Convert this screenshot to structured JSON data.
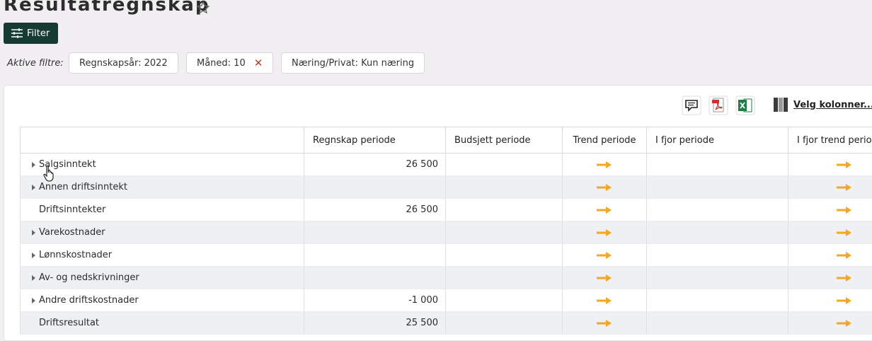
{
  "title": "Resultatregnskap",
  "filter_button": "Filter",
  "active_filters_label": "Aktive filtre:",
  "chips": [
    "Regnskapsår: 2022",
    "Måned: 10",
    "Næring/Privat: Kun næring"
  ],
  "chip_remove_glyph": "✕",
  "velg_kolonner": "Velg kolonner...",
  "columns": [
    "",
    "Regnskap periode",
    "Budsjett periode",
    "Trend periode",
    "I fjor periode",
    "I fjor trend periode"
  ],
  "rows": [
    {
      "label": "Salgsinntekt",
      "regnskap": "26 500"
    },
    {
      "label": "Annen driftsinntekt",
      "regnskap": ""
    },
    {
      "label": "Driftsinntekter",
      "regnskap": "26 500"
    },
    {
      "label": "Varekostnader",
      "regnskap": ""
    },
    {
      "label": "Lønnskostnader",
      "regnskap": ""
    },
    {
      "label": "Av- og nedskrivninger",
      "regnskap": ""
    },
    {
      "label": "Andre driftskostnader",
      "regnskap": "-1 000"
    },
    {
      "label": "Driftsresultat",
      "regnskap": "25 500"
    }
  ],
  "colors": {
    "accent_dark": "#163b32",
    "trend_arrow": "#f5a623",
    "remove": "#c0392b"
  },
  "icons": [
    "star-icon",
    "filter-sliders-icon",
    "close-icon",
    "comment-icon",
    "pdf-icon",
    "excel-icon",
    "columns-icon",
    "expand-caret-icon",
    "trend-arrow-icon",
    "hand-cursor-icon"
  ]
}
